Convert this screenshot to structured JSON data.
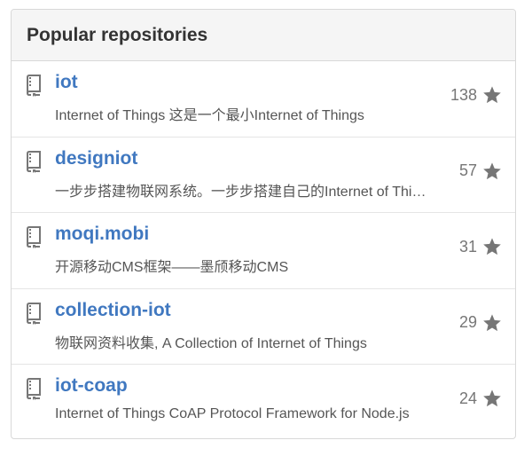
{
  "header": {
    "title": "Popular repositories"
  },
  "colors": {
    "link": "#4078c0",
    "icon": "#767676",
    "header_bg": "#f5f5f5",
    "border": "#d8d8d8"
  },
  "repositories": [
    {
      "name": "iot",
      "description": "Internet of Things 这是一个最小Internet of Things",
      "stars": "138",
      "icon": "repo-icon"
    },
    {
      "name": "designiot",
      "description": "一步步搭建物联网系统。一步步搭建自己的Internet of Things",
      "stars": "57",
      "icon": "repo-icon"
    },
    {
      "name": "moqi.mobi",
      "description": "开源移动CMS框架——墨颀移动CMS",
      "stars": "31",
      "icon": "repo-icon"
    },
    {
      "name": "collection-iot",
      "description": "物联网资料收集, A Collection of Internet of Things",
      "stars": "29",
      "icon": "repo-icon"
    },
    {
      "name": "iot-coap",
      "description": "Internet of Things CoAP Protocol Framework for Node.js",
      "stars": "24",
      "icon": "repo-icon"
    }
  ]
}
